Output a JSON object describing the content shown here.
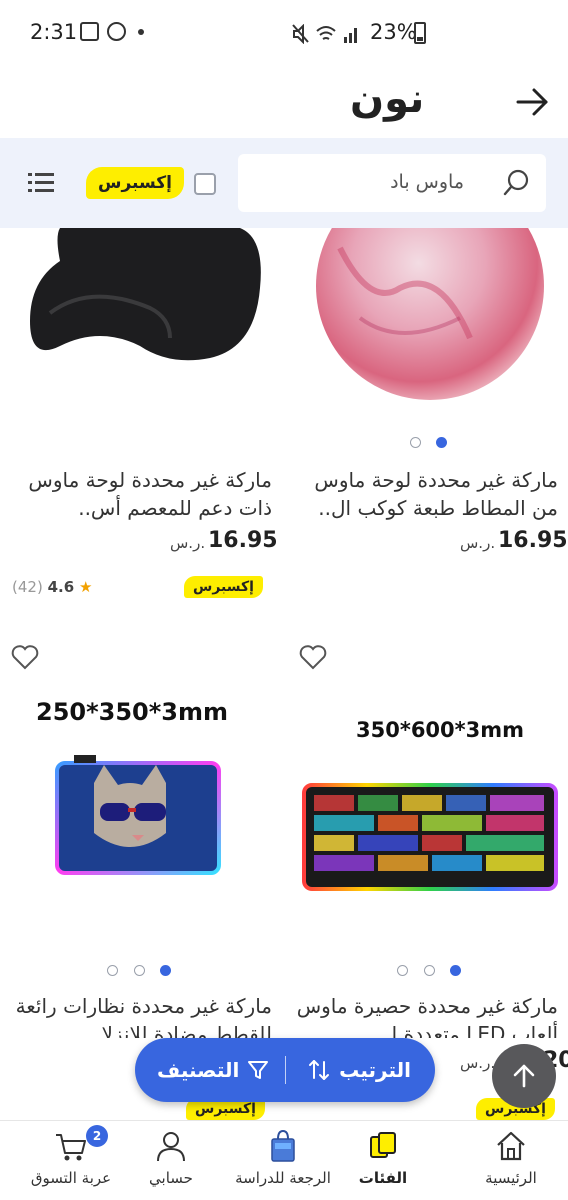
{
  "status_bar": {
    "time": "2:31",
    "battery_percent": "23%"
  },
  "header": {
    "brand": "نون",
    "back_icon": "arrow-right-icon"
  },
  "search": {
    "query": "ماوس باد",
    "express_label": "إكسبرس",
    "express_checked": false
  },
  "products": [
    {
      "title": "ماركة غير محددة لوحة ماوس من المطاط طبعة كوكب ال..",
      "price": "16.95",
      "currency": "ر.س.",
      "carousel_dots": 2,
      "active_dot": 0
    },
    {
      "title": "ماركة غير محددة لوحة ماوس ذات دعم للمعصم أس..",
      "price": "16.95",
      "currency": "ر.س.",
      "express": "إكسبرس",
      "rating": "4.6",
      "rating_count": "(42)"
    },
    {
      "image_text": "350*600*3mm",
      "title": "ماركة غير محددة حصيرة ماوس ألعاب LED متعددة ا..",
      "price": "17.20",
      "currency": "ر.س.",
      "express": "إكسبرس",
      "carousel_dots": 3,
      "active_dot": 0
    },
    {
      "image_text": "250*350*3mm",
      "title": "ماركة غير محددة نظارات رائعة للقطط مضادة للانزلا..",
      "express": "إكسبرس",
      "carousel_dots": 3,
      "active_dot": 0
    }
  ],
  "actions": {
    "sort_label": "الترتيب",
    "filter_label": "التصنيف"
  },
  "bottom_nav": {
    "items": [
      {
        "label": "الرئيسية",
        "icon": "home-icon"
      },
      {
        "label": "الفئات",
        "icon": "categories-icon",
        "active": true
      },
      {
        "label": "الرجعة للدراسة",
        "icon": "shopping-bag-icon"
      },
      {
        "label": "حسابي",
        "icon": "account-icon"
      },
      {
        "label": "عربة التسوق",
        "icon": "cart-icon",
        "badge": "2"
      }
    ]
  },
  "colors": {
    "accent": "#3866df",
    "express_yellow": "#feee00",
    "search_band": "#eef2fb"
  }
}
